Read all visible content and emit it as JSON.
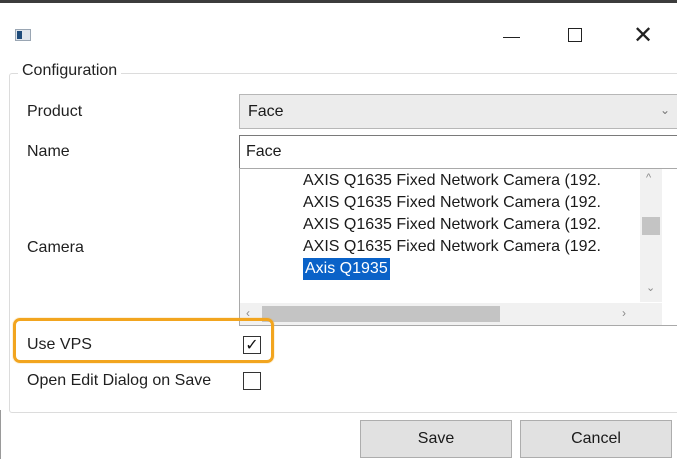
{
  "window": {
    "icon": "app-icon",
    "controls": {
      "minimize": "—",
      "maximize": "☐",
      "close": "✕"
    }
  },
  "group": {
    "title": "Configuration"
  },
  "form": {
    "product": {
      "label": "Product",
      "value": "Face"
    },
    "name": {
      "label": "Name",
      "value": "Face"
    },
    "camera": {
      "label": "Camera",
      "items": [
        "AXIS Q1635 Fixed Network Camera (192.",
        "AXIS Q1635 Fixed Network Camera (192.",
        "AXIS Q1635 Fixed Network Camera (192.",
        "AXIS Q1635 Fixed Network Camera (192.",
        "Axis Q1935"
      ],
      "selected_index": 4
    },
    "use_vps": {
      "label": "Use VPS",
      "checked": true
    },
    "open_edit_dialog": {
      "label": "Open Edit Dialog on Save",
      "checked": false
    }
  },
  "buttons": {
    "save": "Save",
    "cancel": "Cancel"
  },
  "colors": {
    "highlight": "#f2a51f",
    "selection": "#0a62c8"
  }
}
